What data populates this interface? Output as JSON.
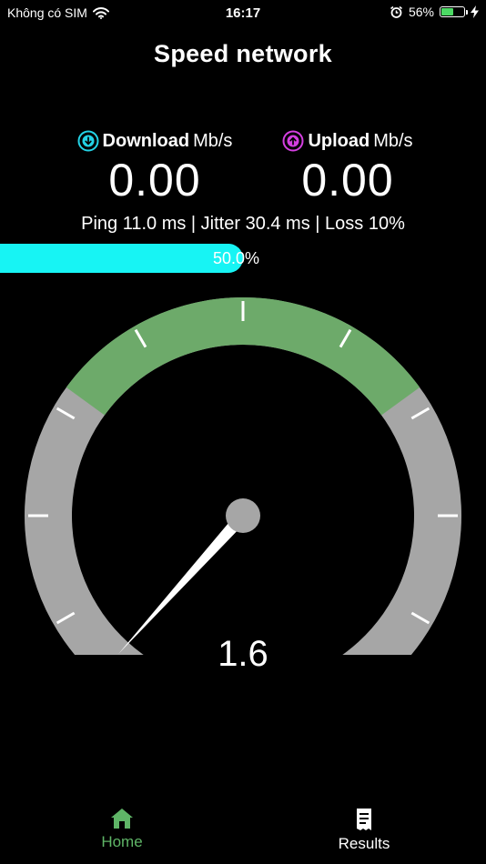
{
  "status_bar": {
    "carrier": "Không có SIM",
    "time": "16:17",
    "battery_percent_label": "56%",
    "battery_level": 0.56,
    "icons": [
      "wifi-icon",
      "alarm-icon",
      "battery-icon",
      "charging-bolt-icon"
    ]
  },
  "app": {
    "title": "Speed network"
  },
  "download": {
    "label": "Download",
    "unit": "Mb/s",
    "value": "0.00",
    "icon": "arrow-down-circle-icon",
    "icon_color": "#23d3e6"
  },
  "upload": {
    "label": "Upload",
    "unit": "Mb/s",
    "value": "0.00",
    "icon": "arrow-up-circle-icon",
    "icon_color": "#d43fe0"
  },
  "stats": {
    "text": "Ping 11.0 ms | Jitter 30.4 ms | Loss 10%"
  },
  "progress": {
    "label": "50.0%",
    "fraction": 0.5,
    "color": "#17f4f4"
  },
  "gauge": {
    "reading": "1.6",
    "colors": {
      "track": "#a6a6a6",
      "highlight": "#6daa6a",
      "ticks": "#ffffff",
      "needle": "#ffffff",
      "hub": "#a6a6a6"
    },
    "highlight_arc_fraction": [
      0.32,
      0.68
    ],
    "needle_fraction": 0.04
  },
  "nav": {
    "home_label": "Home",
    "results_label": "Results",
    "active": "home",
    "active_color": "#5fb567"
  }
}
